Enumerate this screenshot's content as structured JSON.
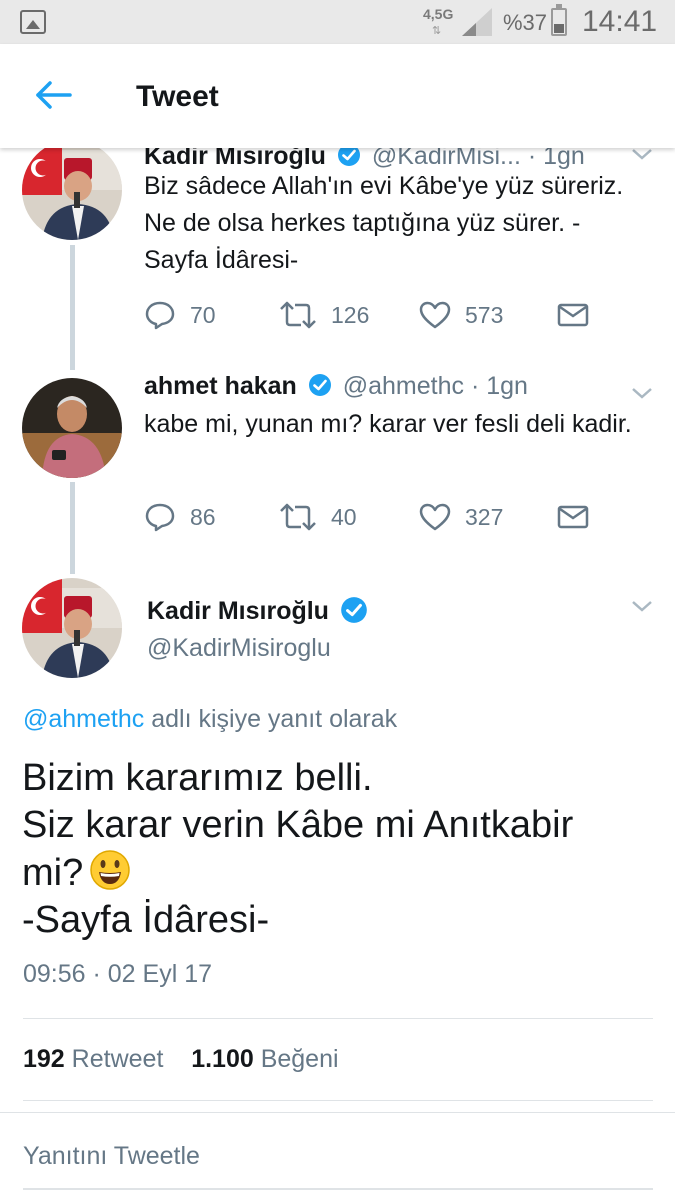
{
  "status_bar": {
    "network": "4,5G",
    "battery": "%37",
    "time": "14:41"
  },
  "header": {
    "title": "Tweet"
  },
  "colors": {
    "accent": "#1da1f2",
    "text": "#14171a",
    "secondary": "#657786",
    "thread_line": "#ccd6dd"
  },
  "thread": [
    {
      "name": "Kadir Mısıroğlu",
      "handle": "@KadirMisi...",
      "time": "· 1gn",
      "text": "Biz sâdece Allah'ın evi Kâbe'ye yüz süreriz. Ne de olsa herkes taptığına yüz sürer. -Sayfa İdâresi-",
      "replies": "70",
      "retweets": "126",
      "likes": "573"
    },
    {
      "name": "ahmet hakan",
      "handle": "@ahmethc",
      "time": "· 1gn",
      "text": "kabe mi, yunan mı? karar ver fesli deli kadir.",
      "replies": "86",
      "retweets": "40",
      "likes": "327"
    }
  ],
  "main_tweet": {
    "name": "Kadir Mısıroğlu",
    "handle": "@KadirMisiroglu",
    "reply_link": "@ahmethc",
    "reply_suffix": "adlı kişiye yanıt olarak",
    "lines": [
      "Bizim kararımız belli.",
      "Siz karar verin Kâbe mi Anıtkabir",
      "mi?",
      "-Sayfa İdâresi-"
    ],
    "emoji": "grinning-face-emoji",
    "timestamp": "09:56 · 02 Eyl 17",
    "retweet_count": "192",
    "retweet_label": "Retweet",
    "like_count": "1.100",
    "like_label": "Beğeni"
  },
  "reply_prompt": "Yanıtını Tweetle"
}
